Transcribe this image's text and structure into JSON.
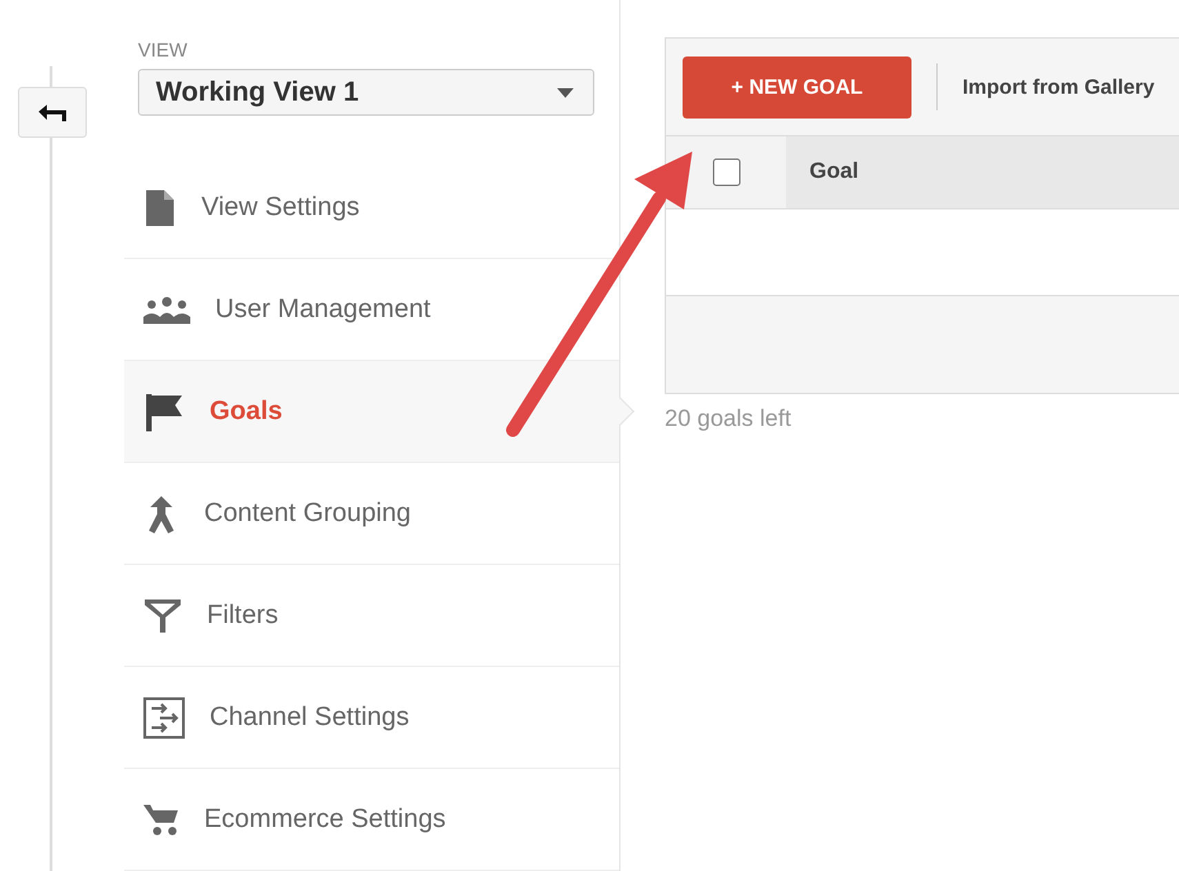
{
  "view": {
    "label": "VIEW",
    "selected_view": "Working View 1"
  },
  "menu": [
    {
      "kind": "document",
      "label": "View Settings",
      "selected": false
    },
    {
      "kind": "users",
      "label": "User Management",
      "selected": false
    },
    {
      "kind": "flag",
      "label": "Goals",
      "selected": true
    },
    {
      "kind": "merge",
      "label": "Content Grouping",
      "selected": false
    },
    {
      "kind": "filter",
      "label": "Filters",
      "selected": false
    },
    {
      "kind": "channel",
      "label": "Channel Settings",
      "selected": false
    },
    {
      "kind": "cart",
      "label": "Ecommerce Settings",
      "selected": false
    }
  ],
  "toolbar": {
    "new_button": "+ NEW GOAL",
    "import_link": "Import from Gallery"
  },
  "table": {
    "columns": [
      "Goal"
    ],
    "select_all_checked": false
  },
  "goals_left": "20 goals left"
}
